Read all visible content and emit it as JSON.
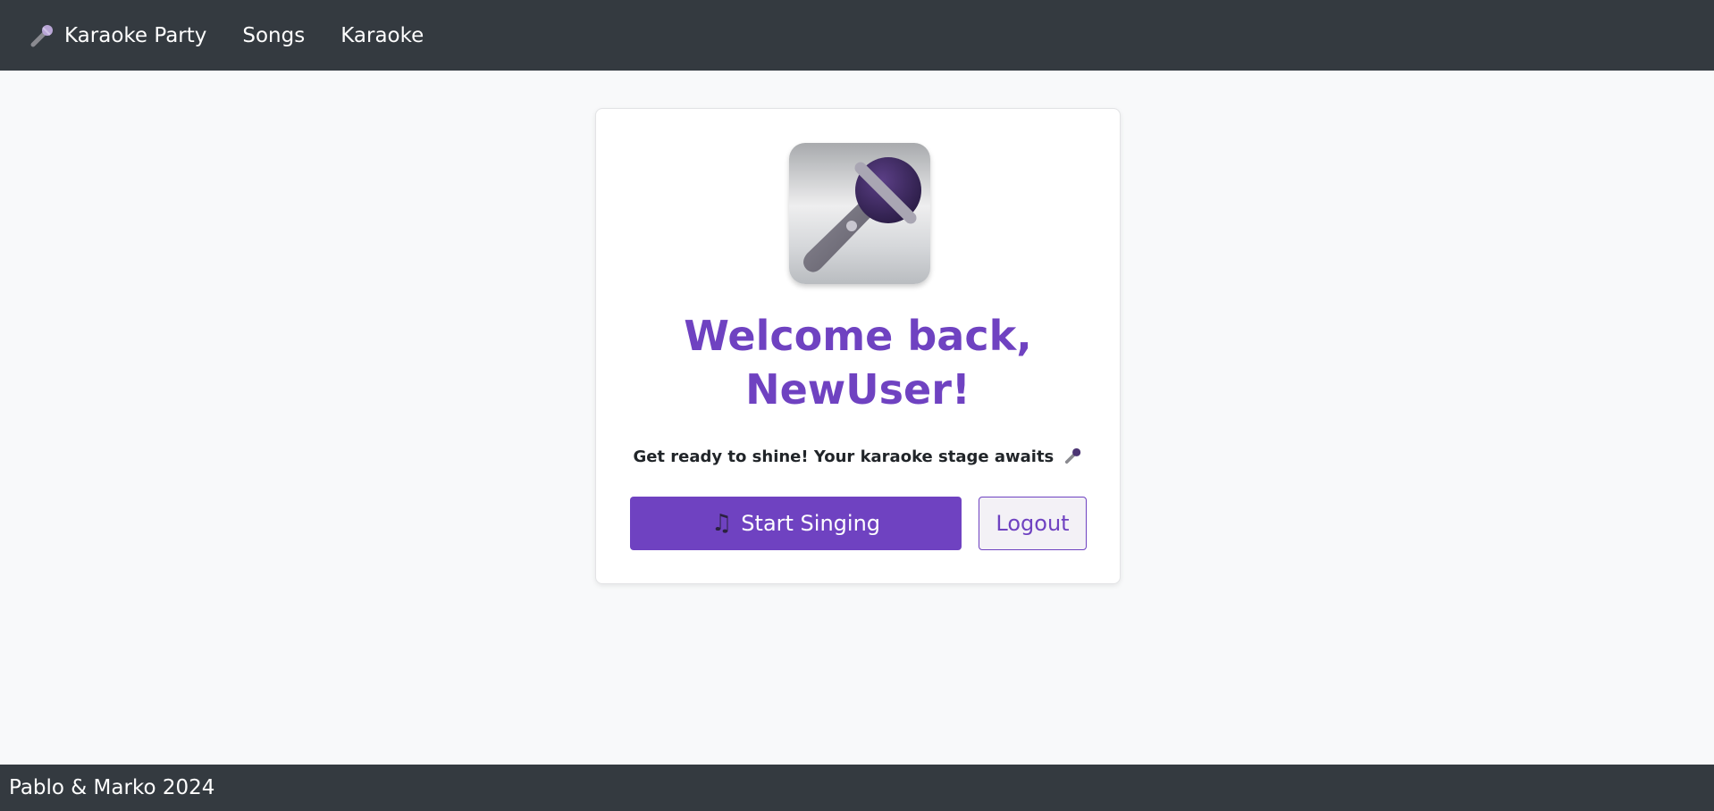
{
  "navbar": {
    "brand_label": "Karaoke Party",
    "brand_icon": "microphone-icon",
    "links": [
      {
        "label": "Songs"
      },
      {
        "label": "Karaoke"
      }
    ]
  },
  "welcome_card": {
    "icon": "microphone-icon",
    "title_line1": "Welcome back,",
    "title_line2": "NewUser!",
    "tagline": "Get ready to shine! Your karaoke stage awaits",
    "tagline_icon": "microphone-icon",
    "start_button": {
      "icon": "music-notes-icon",
      "label": "Start Singing"
    },
    "logout_button": {
      "label": "Logout"
    }
  },
  "footer": {
    "text": "Pablo & Marko 2024"
  },
  "colors": {
    "navbar_bg": "#343a40",
    "accent": "#6f42c1",
    "page_bg": "#f8f9fa"
  }
}
